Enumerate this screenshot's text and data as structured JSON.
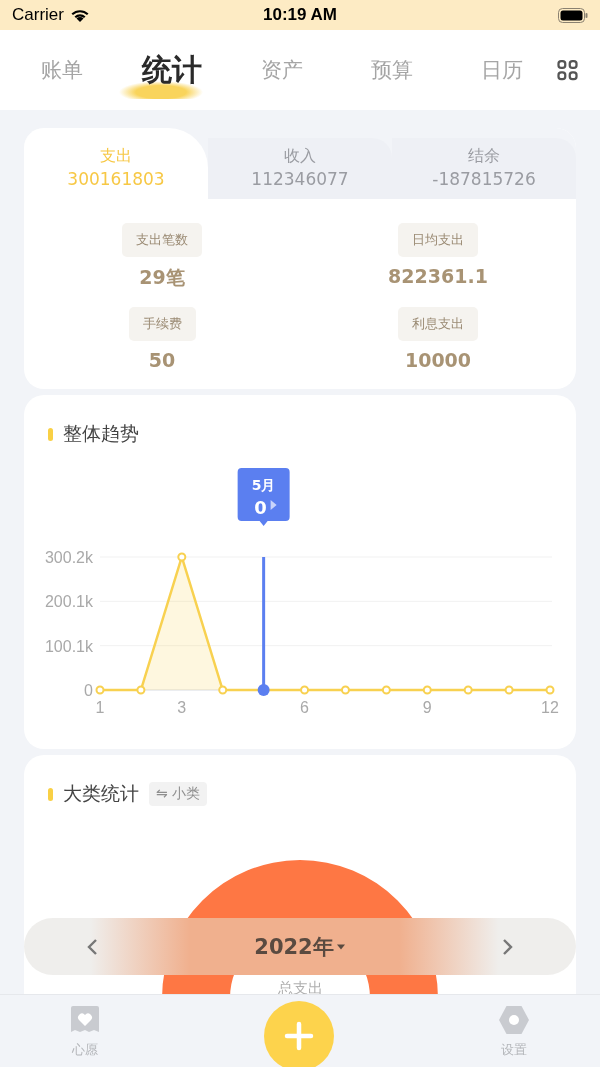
{
  "status_bar": {
    "carrier": "Carrier",
    "time": "10:19 AM"
  },
  "nav_tabs": [
    {
      "label": "账单",
      "selected": false
    },
    {
      "label": "统计",
      "selected": true
    },
    {
      "label": "资产",
      "selected": false
    },
    {
      "label": "预算",
      "selected": false
    },
    {
      "label": "日历",
      "selected": false
    }
  ],
  "summary": {
    "tabs": [
      {
        "label": "支出",
        "amount": "300161803",
        "selected": true
      },
      {
        "label": "收入",
        "amount": "112346077",
        "selected": false
      },
      {
        "label": "结余",
        "amount": "-187815726",
        "selected": false
      }
    ],
    "stats": [
      {
        "label": "支出笔数",
        "value": "29笔"
      },
      {
        "label": "日均支出",
        "value": "822361.1"
      },
      {
        "label": "手续费",
        "value": "50"
      },
      {
        "label": "利息支出",
        "value": "10000"
      }
    ]
  },
  "trend": {
    "title": "整体趋势",
    "chart_data": {
      "type": "area",
      "x": [
        1,
        2,
        3,
        4,
        5,
        6,
        7,
        8,
        9,
        10,
        11,
        12
      ],
      "series": [
        {
          "color": "#f8d150",
          "values": [
            0,
            0,
            300200,
            0,
            0,
            0,
            0,
            0,
            0,
            0,
            0,
            0
          ]
        }
      ],
      "xticks": [
        1,
        3,
        6,
        9,
        12
      ],
      "xlim": [
        1,
        12
      ],
      "ylim": [
        0,
        300200
      ],
      "ref_lines": [
        {
          "axis": "x",
          "value": 5,
          "color": "#5b7ff0"
        }
      ],
      "yticks": [
        {
          "value": 0,
          "label": "0"
        },
        {
          "value": 100100,
          "label": "100.1k"
        },
        {
          "value": 200100,
          "label": "200.1k"
        },
        {
          "value": 300200,
          "label": "300.2k"
        }
      ],
      "annotations": [
        "5月"
      ]
    },
    "tooltip_value": "0"
  },
  "category": {
    "title": "大类统计",
    "switch_label": "⇋ 小类",
    "center_label": "总支出"
  },
  "year_selector": {
    "label": "2022年"
  },
  "bottom_bar": [
    {
      "kind": "wish",
      "label": "心愿"
    },
    {
      "kind": "add"
    },
    {
      "kind": "settings",
      "label": "设置"
    }
  ]
}
